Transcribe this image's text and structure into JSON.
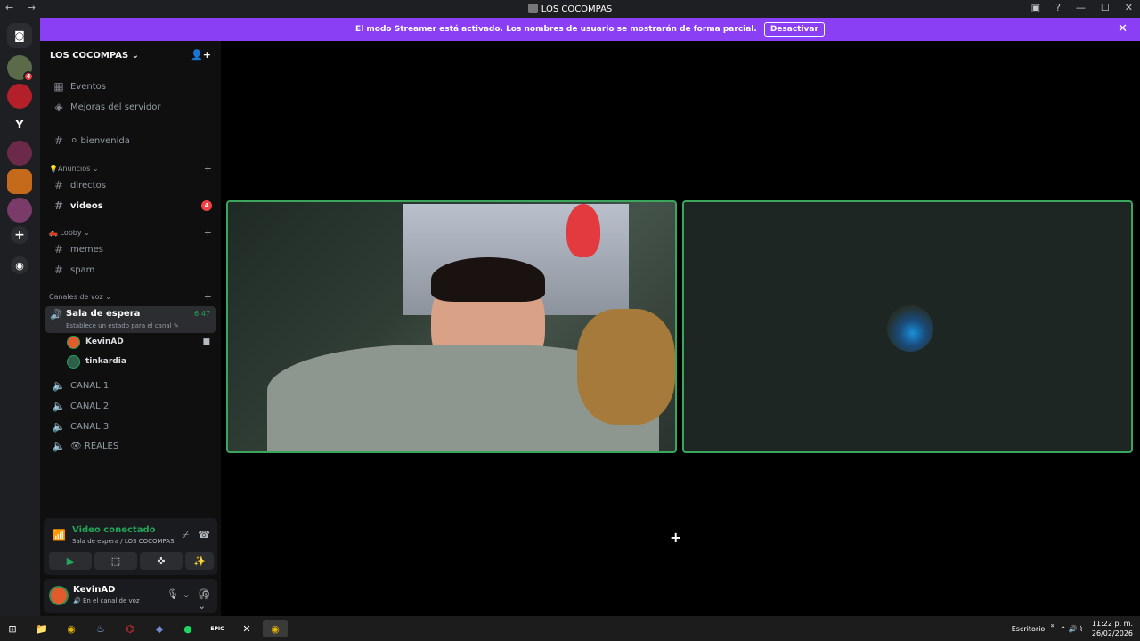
{
  "window": {
    "title": "LOS COCOMPAS",
    "nav_glyphs": "← →",
    "controls": [
      "▣",
      "?",
      "—",
      "☐",
      "✕"
    ]
  },
  "banner": {
    "message": "El modo Streamer está activado. Los nombres de usuario se mostrarán de forma parcial.",
    "button": "Desactivar",
    "close": "✕"
  },
  "rail": {
    "servers": [
      {
        "label": "",
        "color": "#5b6b4a",
        "badge": "4"
      },
      {
        "label": "",
        "color": "#b3202a",
        "badge": ""
      },
      {
        "label": "Y",
        "color": "#1e1f22",
        "badge": ""
      },
      {
        "label": "",
        "color": "#6b2a4a",
        "badge": ""
      },
      {
        "label": "",
        "color": "#c46a1a",
        "badge": ""
      },
      {
        "label": "",
        "color": "#7a3a6a",
        "badge": ""
      },
      {
        "label": "+",
        "color": "#2b2d31",
        "badge": ""
      },
      {
        "label": "◉",
        "color": "#2b2d31",
        "badge": ""
      }
    ]
  },
  "server": {
    "name": "LOS COCOMPAS",
    "chevron": "⌄",
    "invite_icon": "👤+"
  },
  "sidebar": {
    "events": "Eventos",
    "boosts": "Mejoras del servidor",
    "welcome": "⚪ bienvenida",
    "categories": {
      "anuncios": "💡Anuncios ⌄",
      "lobby": "🛻 Lobby ⌄",
      "voice": "Canales de voz ⌄"
    },
    "channels": {
      "directos": "directos",
      "videos": "videos",
      "videos_badge": "4",
      "memes": "memes",
      "spam": "spam"
    },
    "voice_active": {
      "name": "Sala de espera",
      "time": "6:47",
      "status": "Establece un estado para el canal ✎"
    },
    "members": [
      {
        "name": "KevinAD",
        "color": "#e25b2d"
      },
      {
        "name": "tinkardia",
        "color": "#2f5d4a"
      }
    ],
    "voice_channels": [
      "CANAL 1",
      "CANAL 2",
      "CANAL 3",
      "👁 REALES"
    ]
  },
  "rtc": {
    "title": "Video conectado",
    "subtitle": "Sala de espera / LOS COCOMPAS",
    "buttons": [
      "▶",
      "⬚",
      "✜",
      "✨"
    ]
  },
  "user": {
    "name": "KevinAD",
    "status": "🔊 En el canal de voz",
    "controls": [
      "🎙 ⌄",
      "🎧 ⌄",
      "⚙"
    ]
  },
  "taskbar": {
    "apps": [
      "⊞",
      "📁",
      "◉",
      "♨",
      "⌬",
      "◆",
      "●",
      "EPIC",
      "✕",
      "◉"
    ],
    "desktop_label": "Escritorio",
    "chevron": "»",
    "tray_icons": "⌃ 🔊 ⌇",
    "time": "11:22 p. m.",
    "date": "26/02/2026"
  }
}
